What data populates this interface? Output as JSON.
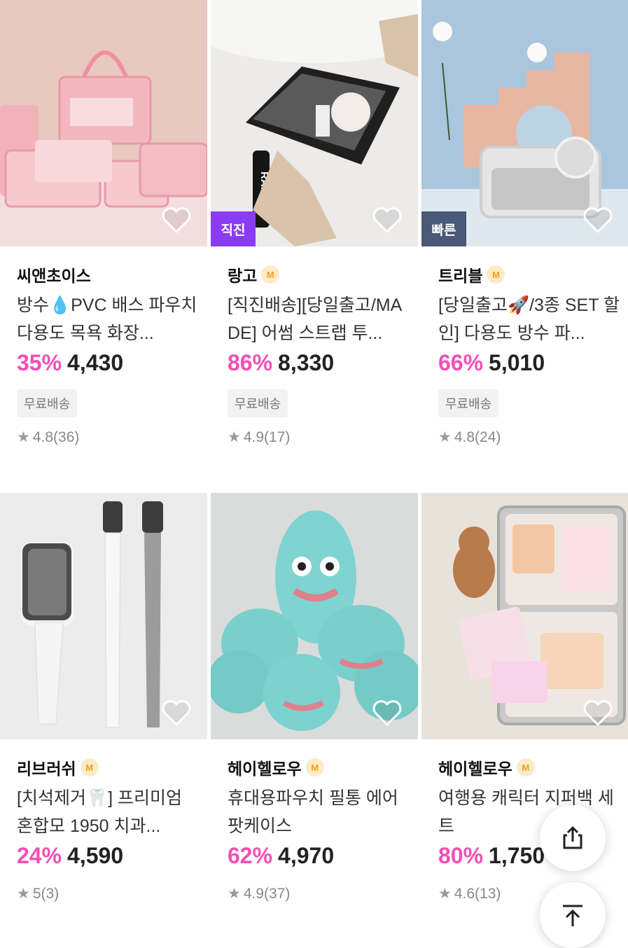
{
  "products": [
    {
      "seller": "씨앤초이스",
      "mall_badge": "",
      "title": "방수💧PVC 배스 파우치 다용도 목욕 화장...",
      "discount": "35%",
      "price": "4,430",
      "shipping": "무료배송",
      "rating": "4.8",
      "reviews": "(36)",
      "badge": "",
      "image_icon": "washbag-pink-photo"
    },
    {
      "seller": "랑고",
      "mall_badge": "M",
      "title": "[직진배송][당일출고/MADE] 어썸 스트랩 투...",
      "discount": "86%",
      "price": "8,330",
      "shipping": "무료배송",
      "rating": "4.9",
      "reviews": "(17)",
      "badge": "직진",
      "badge_color": "#8a3cf5",
      "image_icon": "black-pouch-photo"
    },
    {
      "seller": "트리블",
      "mall_badge": "M",
      "title": "[당일출고🚀/3종 SET 할인] 다용도 방수 파...",
      "discount": "66%",
      "price": "5,010",
      "shipping": "무료배송",
      "rating": "4.8",
      "reviews": "(24)",
      "badge": "빠른",
      "badge_color": "#4a5877",
      "image_icon": "clear-washbag-photo"
    },
    {
      "seller": "리브러쉬",
      "mall_badge": "M",
      "title": "[치석제거🦷] 프리미엄 혼합모 1950 치과...",
      "discount": "24%",
      "price": "4,590",
      "shipping": "",
      "rating": "5",
      "reviews": "(3)",
      "badge": "",
      "image_icon": "toothbrush-photo"
    },
    {
      "seller": "헤이헬로우",
      "mall_badge": "M",
      "title": "휴대용파우치 필통 에어팟케이스",
      "discount": "62%",
      "price": "4,970",
      "shipping": "",
      "rating": "4.9",
      "reviews": "(37)",
      "badge": "",
      "image_icon": "plush-pouch-photo"
    },
    {
      "seller": "헤이헬로우",
      "mall_badge": "M",
      "title": "여행용 캐릭터 지퍼백 세트",
      "discount": "80%",
      "price": "1,750",
      "shipping": "",
      "rating": "4.6",
      "reviews": "(13)",
      "badge": "",
      "image_icon": "zipper-bag-set-photo"
    }
  ],
  "colors": {
    "discount": "#f24fb6",
    "mall_badge_bg": "#fdebc8",
    "mall_badge_fg": "#f2a019"
  },
  "floating": {
    "share_icon": "share-icon",
    "top_icon": "scroll-top-icon"
  }
}
